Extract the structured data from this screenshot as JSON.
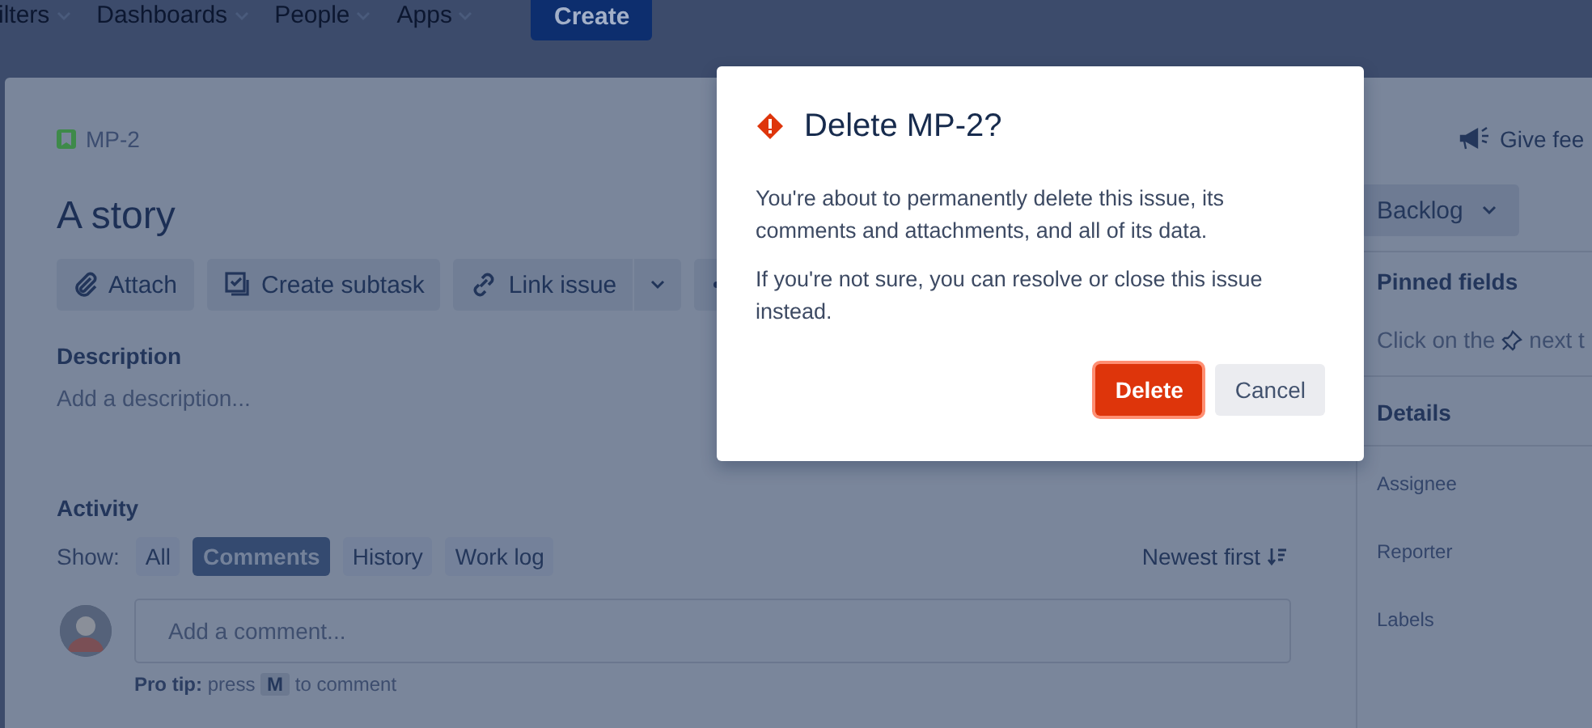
{
  "nav": {
    "items": [
      {
        "label": "ilters"
      },
      {
        "label": "Dashboards"
      },
      {
        "label": "People"
      },
      {
        "label": "Apps"
      }
    ],
    "create": "Create"
  },
  "issue": {
    "key": "MP-2",
    "title": "A story",
    "toolbar": [
      {
        "kind": "attach",
        "label": "Attach"
      },
      {
        "kind": "subtask",
        "label": "Create subtask"
      },
      {
        "kind": "link",
        "label": "Link issue"
      }
    ],
    "description": {
      "label": "Description",
      "placeholder": "Add a description..."
    },
    "activity": {
      "label": "Activity",
      "show": "Show:",
      "filters": [
        {
          "label": "All",
          "selected": false
        },
        {
          "label": "Comments",
          "selected": true
        },
        {
          "label": "History",
          "selected": false
        },
        {
          "label": "Work log",
          "selected": false
        }
      ],
      "sort": "Newest first",
      "comment_placeholder": "Add a comment...",
      "tip": {
        "bold": "Pro tip:",
        "before": "press",
        "key": "M",
        "after": "to comment"
      }
    }
  },
  "sidebar": {
    "feedback": "Give fee",
    "status": "Backlog",
    "pinned": {
      "title": "Pinned fields",
      "before": "Click on the",
      "after": "next t"
    },
    "details": {
      "title": "Details",
      "fields": [
        "Assignee",
        "Reporter",
        "Labels"
      ]
    }
  },
  "dialog": {
    "title": "Delete MP-2?",
    "paragraphs": [
      "You're about to permanently delete this issue, its comments and attachments, and all of its data.",
      "If you're not sure, you can resolve or close this issue instead."
    ],
    "buttons": [
      {
        "kind": "danger",
        "label": "Delete"
      },
      {
        "kind": "subtle",
        "label": "Cancel"
      }
    ]
  }
}
